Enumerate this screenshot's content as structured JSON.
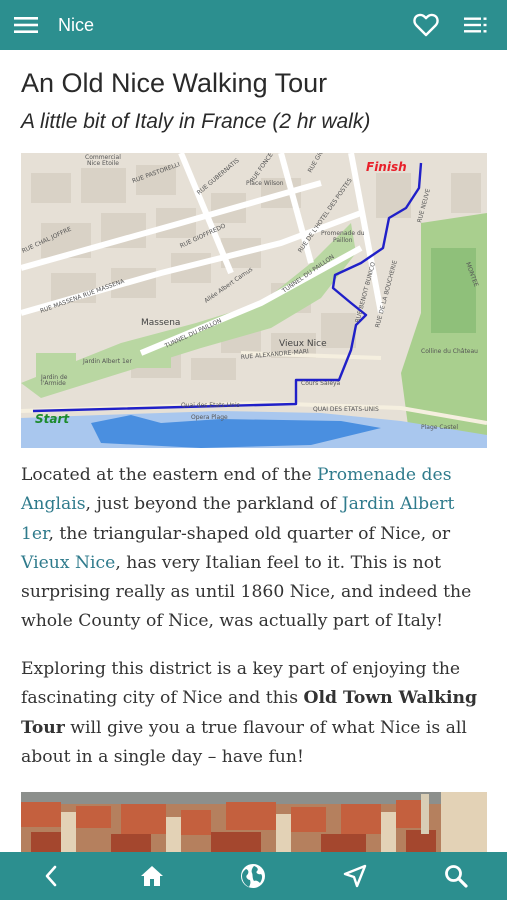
{
  "appbar": {
    "title": "Nice",
    "menu_icon": "hamburger-menu-icon",
    "favorite_icon": "heart-icon",
    "list_icon": "list-icon"
  },
  "page": {
    "title": "An Old Nice Walking Tour",
    "subtitle": "A little bit of Italy in France (2 hr walk)"
  },
  "map": {
    "route_color": "#2020c8",
    "finish_label": "Finish",
    "start_label": "Start",
    "streets": [
      "Commercial Nice Etoile",
      "RUE PASTORELLI",
      "RUE GUBERNATIS",
      "RUE FONCET",
      "RUE GIOFFREDO",
      "RUE DE L'HOTEL DES POSTES",
      "RUE MASSENA",
      "RUE MASSENA",
      "RUE DU PAILLON",
      "TUNNEL DU PAILLON",
      "TUNNEL DU PAILLON",
      "Massena",
      "Jardin Albert 1er",
      "Jardin de l'Armide",
      "Vieux Nice",
      "RUE ALEXANDRE-MARI",
      "Cours Saleya",
      "Quai des Etats-Unis",
      "QUAI DES ETATS-UNIS",
      "Opera Plage",
      "Plage Castel",
      "Colline du Chateau",
      "Promenade du Paillon",
      "RUE NEUVE",
      "MONTEE",
      "Place Wilson",
      "RUE CHAL JOFFRE",
      "RUE DE LA BOUCHERIE"
    ]
  },
  "paragraph1": {
    "t1": "Located at the eastern end of the ",
    "link1": "Promenade des Anglais",
    "t2": ", just beyond the parkland of ",
    "link2": "Jardin Albert 1er",
    "t3": ", the triangular-shaped old quarter of Nice, or ",
    "link3": "Vieux Nice",
    "t4": ", has very Italian feel to it. This is not surprising really as until 1860 Nice, and indeed the whole County of Nice, was actually part of Italy!"
  },
  "paragraph2": {
    "t1": "Exploring this district is a key part of enjoying the fascinating city of Nice and this ",
    "bold": "Old Town Walking Tour",
    "t2": " will give you a true flavour of what Nice is all about in a single day – have fun!"
  },
  "bottom_nav": {
    "items": [
      "back-icon",
      "home-icon",
      "globe-icon",
      "navigate-icon",
      "search-icon"
    ]
  },
  "colors": {
    "primary": "#2c8f8f",
    "link": "#2f7b8c"
  }
}
